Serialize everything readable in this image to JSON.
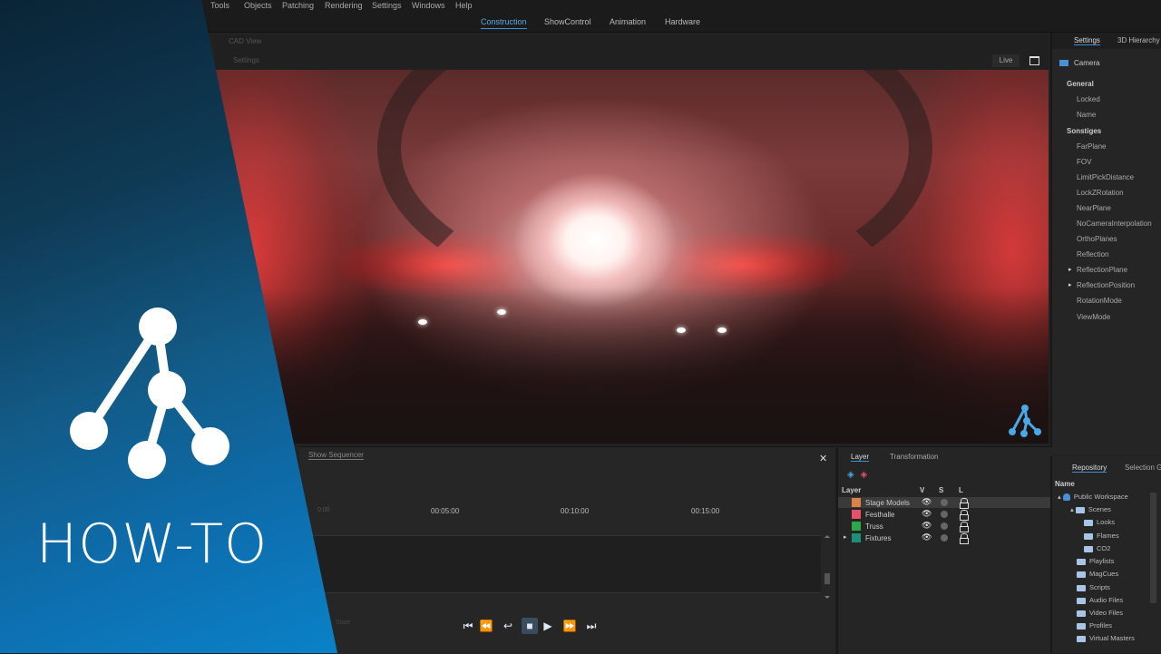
{
  "menu": [
    "Tools",
    "Objects",
    "Patching",
    "Rendering",
    "Settings",
    "Windows",
    "Help"
  ],
  "modes": [
    {
      "label": "Construction",
      "active": true
    },
    {
      "label": "ShowControl",
      "active": false
    },
    {
      "label": "Animation",
      "active": false
    },
    {
      "label": "Hardware",
      "active": false
    }
  ],
  "viewport": {
    "title": "CAD View",
    "settings_label": "Settings",
    "live_label": "Live"
  },
  "settings_panel": {
    "tabs": [
      "Settings",
      "3D Hierarchy"
    ],
    "object": "Camera",
    "groups": [
      {
        "name": "General",
        "props": [
          {
            "name": "Locked"
          },
          {
            "name": "Name"
          }
        ]
      },
      {
        "name": "Sonstiges",
        "props": [
          {
            "name": "FarPlane"
          },
          {
            "name": "FOV"
          },
          {
            "name": "LimitPickDistance"
          },
          {
            "name": "LockZRotation"
          },
          {
            "name": "NearPlane"
          },
          {
            "name": "NoCameraInterpolation"
          },
          {
            "name": "OrthoPlanes"
          },
          {
            "name": "Reflection"
          },
          {
            "name": "ReflectionPlane",
            "expandable": true
          },
          {
            "name": "ReflectionPosition",
            "expandable": true
          },
          {
            "name": "RotationMode"
          },
          {
            "name": "ViewMode"
          }
        ]
      }
    ]
  },
  "sequencer": {
    "tab": "Show Sequencer",
    "start_label": "0:00",
    "ticks": [
      "00:05:00",
      "00:10:00",
      "00:15:00"
    ],
    "state_label": "State",
    "transport": [
      "skip-back-icon",
      "rewind-icon",
      "loop-icon",
      "stop-icon",
      "play-icon",
      "fast-forward-icon",
      "skip-forward-icon"
    ]
  },
  "layer_panel": {
    "tabs": [
      "Layer",
      "Transformation"
    ],
    "headers": {
      "name": "Layer",
      "v": "V",
      "s": "S",
      "l": "L"
    },
    "layers": [
      {
        "name": "Stage Models",
        "color": "#d9824a",
        "selected": true,
        "expandable": false
      },
      {
        "name": "Festhalle",
        "color": "#e8506a",
        "selected": false,
        "expandable": false
      },
      {
        "name": "Truss",
        "color": "#2aa84a",
        "selected": false,
        "expandable": false
      },
      {
        "name": "Fixtures",
        "color": "#1f8f7a",
        "selected": false,
        "expandable": true
      }
    ]
  },
  "repository": {
    "tabs": [
      "Repository",
      "Selection G"
    ],
    "header": "Name",
    "items": [
      {
        "label": "Public Workspace",
        "level": 0,
        "type": "person"
      },
      {
        "label": "Scenes",
        "level": 1,
        "type": "folder"
      },
      {
        "label": "Looks",
        "level": 2,
        "type": "folder"
      },
      {
        "label": "Flames",
        "level": 2,
        "type": "folder"
      },
      {
        "label": "CO2",
        "level": 2,
        "type": "folder"
      },
      {
        "label": "Playlists",
        "level": 1,
        "type": "folder"
      },
      {
        "label": "MagCues",
        "level": 1,
        "type": "folder"
      },
      {
        "label": "Scripts",
        "level": 1,
        "type": "folder"
      },
      {
        "label": "Audio Files",
        "level": 1,
        "type": "folder"
      },
      {
        "label": "Video Files",
        "level": 1,
        "type": "folder"
      },
      {
        "label": "Profiles",
        "level": 1,
        "type": "folder"
      },
      {
        "label": "Virtual Masters",
        "level": 1,
        "type": "folder"
      }
    ]
  },
  "overlay": {
    "title": "HOW-TO"
  },
  "colors": {
    "accent": "#3d8fd6",
    "overlay_blue": "#0a82c8"
  }
}
